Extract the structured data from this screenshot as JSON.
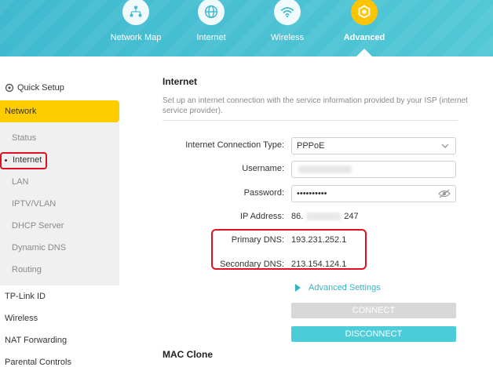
{
  "nav": {
    "items": [
      {
        "label": "Network Map",
        "icon": "network-map-icon"
      },
      {
        "label": "Internet",
        "icon": "globe-icon"
      },
      {
        "label": "Wireless",
        "icon": "wifi-icon"
      },
      {
        "label": "Advanced",
        "icon": "gear-icon",
        "active": true
      }
    ]
  },
  "sidebar": {
    "quick_setup": "Quick Setup",
    "network": "Network",
    "sub_items": [
      "Status",
      "Internet",
      "LAN",
      "IPTV/VLAN",
      "DHCP Server",
      "Dynamic DNS",
      "Routing"
    ],
    "active_sub": "Internet",
    "bottom_items": [
      "TP-Link ID",
      "Wireless",
      "NAT Forwarding",
      "Parental Controls"
    ]
  },
  "main": {
    "title": "Internet",
    "description": "Set up an internet connection with the service information provided by your ISP (internet service provider).",
    "fields": {
      "connection_type_label": "Internet Connection Type:",
      "connection_type_value": "PPPoE",
      "username_label": "Username:",
      "password_label": "Password:",
      "password_value": "••••••••••",
      "ip_label": "IP Address:",
      "ip_prefix": "86.",
      "ip_suffix": "247",
      "primary_dns_label": "Primary DNS:",
      "primary_dns_value": "193.231.252.1",
      "secondary_dns_label": "Secondary DNS:",
      "secondary_dns_value": "213.154.124.1"
    },
    "advanced_settings": "Advanced Settings",
    "connect": "CONNECT",
    "disconnect": "DISCONNECT",
    "mac_clone_title": "MAC Clone"
  },
  "colors": {
    "header": "#4ac4d4",
    "accent_yellow": "#ffcc00",
    "accent_teal": "#35b4c8",
    "highlight_red": "#e01020"
  }
}
